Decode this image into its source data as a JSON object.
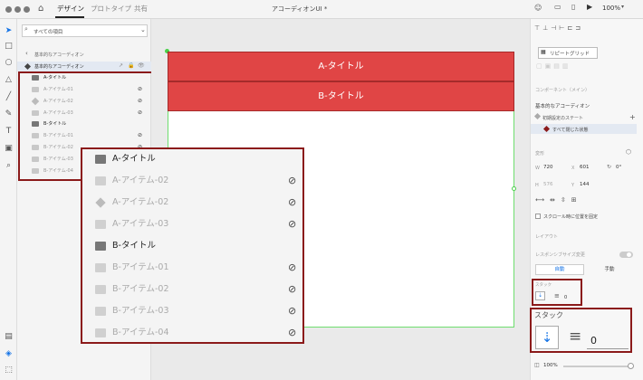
{
  "menu": {
    "home_icon": "home-icon",
    "tabs": [
      "デザイン",
      "プロトタイプ",
      "共有"
    ],
    "doc_title": "アコーディオンUI *",
    "zoom": "100%"
  },
  "layers": {
    "search_placeholder": "すべての項目",
    "breadcrumb": "基本的なアコーディオン",
    "component": "基本的なアコーディオン",
    "rows": [
      "A-タイトル",
      "A-アイテム-01",
      "A-アイテム-02",
      "A-アイテム-03",
      "B-タイトル",
      "B-アイテム-01",
      "B-アイテム-02",
      "B-アイテム-03",
      "B-アイテム-04"
    ]
  },
  "zoom_layers": {
    "rows": [
      "A-タイトル",
      "A-アイテム-02",
      "A-アイテム-02",
      "A-アイテム-03",
      "B-タイトル",
      "B-アイテム-01",
      "B-アイテム-02",
      "B-アイテム-03",
      "B-アイテム-04"
    ]
  },
  "canvas": {
    "row_a": "A-タイトル",
    "row_b": "B-タイトル"
  },
  "props": {
    "repeat_grid": "リピートグリッド",
    "component_label": "コンポーネント（メイン）",
    "component_name": "基本的なアコーディオン",
    "default_state": "初期設定のステート",
    "state2": "すべて閉じた状態",
    "transform_label": "変形",
    "w": "720",
    "x": "601",
    "h": "576",
    "y": "144",
    "rot": "0°",
    "fix_scroll": "スクロール時に位置を固定",
    "layout_label": "レイアウト",
    "responsive": "レスポンシブサイズ変更",
    "auto": "自動",
    "manual": "手動",
    "stack_small": "スタック",
    "stack_small_val": "0",
    "stack_big": "スタック",
    "stack_big_val": "0",
    "opacity": "100%"
  }
}
